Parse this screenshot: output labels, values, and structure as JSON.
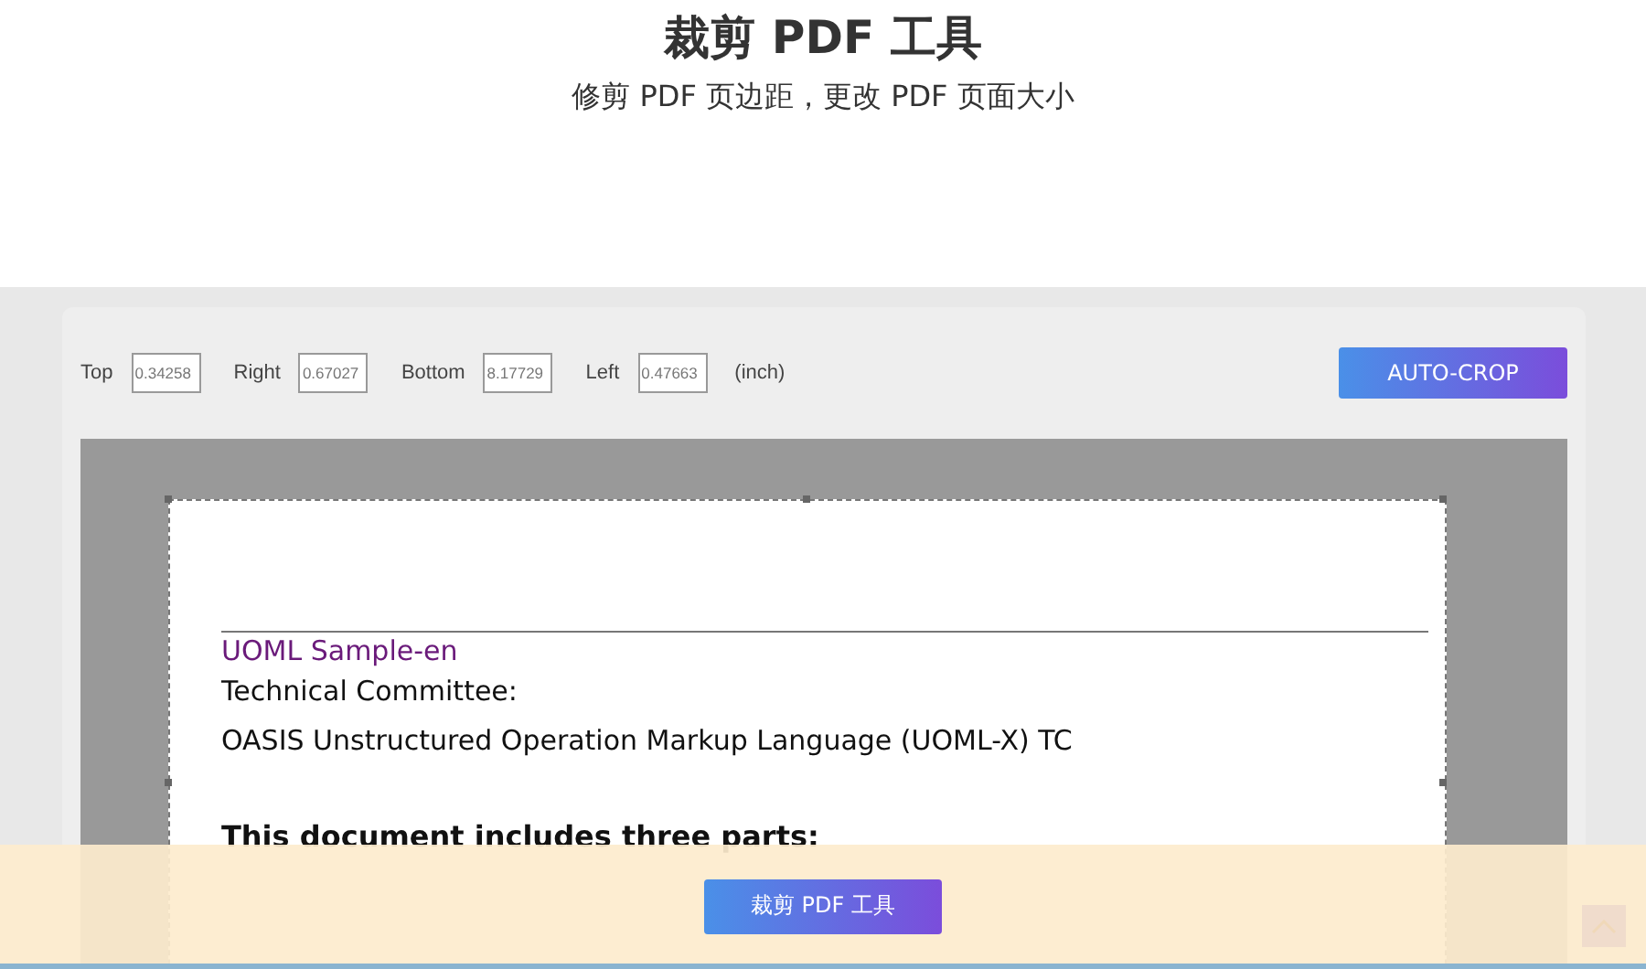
{
  "header": {
    "title": "裁剪 PDF 工具",
    "subtitle": "修剪 PDF 页边距，更改 PDF 页面大小"
  },
  "crop_fields": [
    {
      "label": "Top",
      "value": "0.34258"
    },
    {
      "label": "Right",
      "value": "0.67027"
    },
    {
      "label": "Bottom",
      "value": "8.17729"
    },
    {
      "label": "Left",
      "value": "0.47663"
    }
  ],
  "unit": "(inch)",
  "auto_crop_button": "AUTO-CROP",
  "document": {
    "header": "UOML Sample-en",
    "lines": [
      "Technical Committee:",
      "OASIS Unstructured Operation Markup Language (UOML-X) TC"
    ],
    "heading": "This document includes three parts:"
  },
  "bottom_bar": {
    "button": "裁剪 PDF 工具"
  }
}
